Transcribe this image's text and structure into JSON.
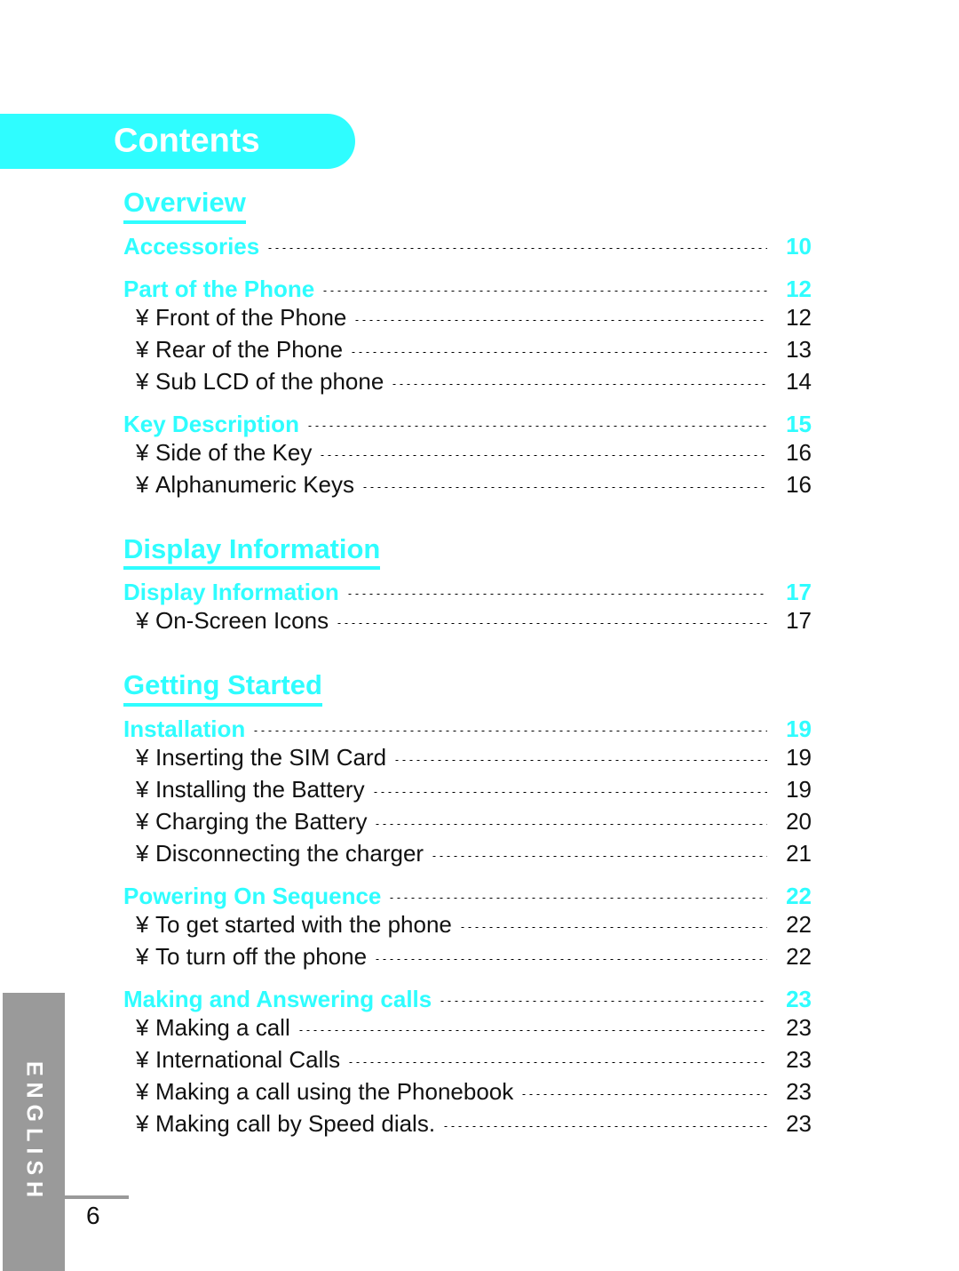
{
  "banner": {
    "title": "Contents"
  },
  "bullet_glyph": "¥",
  "colors": {
    "accent_cyan": "#2ffdff",
    "tab_gray": "#9a9a9a",
    "body_black": "#111111",
    "banner_text": "#ffffff"
  },
  "sections": [
    {
      "title": "Overview",
      "groups": [
        {
          "main": {
            "label": "Accessories",
            "page": "10"
          },
          "subs": []
        },
        {
          "main": {
            "label": "Part of the Phone",
            "page": "12"
          },
          "subs": [
            {
              "label": "Front of the Phone",
              "page": "12"
            },
            {
              "label": "Rear of the Phone",
              "page": "13"
            },
            {
              "label": "Sub LCD of the phone",
              "page": "14"
            }
          ]
        },
        {
          "main": {
            "label": "Key Description",
            "page": "15"
          },
          "subs": [
            {
              "label": "Side of the Key",
              "page": "16"
            },
            {
              "label": "Alphanumeric Keys",
              "page": "16"
            }
          ]
        }
      ]
    },
    {
      "title": "Display Information",
      "groups": [
        {
          "main": {
            "label": "Display Information",
            "page": "17"
          },
          "subs": [
            {
              "label": "On-Screen Icons",
              "page": "17"
            }
          ]
        }
      ]
    },
    {
      "title": "Getting Started",
      "groups": [
        {
          "main": {
            "label": "Installation",
            "page": "19"
          },
          "subs": [
            {
              "label": "Inserting the SIM Card",
              "page": "19"
            },
            {
              "label": "Installing the Battery",
              "page": "19"
            },
            {
              "label": "Charging the Battery",
              "page": "20"
            },
            {
              "label": "Disconnecting the charger",
              "page": "21"
            }
          ]
        },
        {
          "main": {
            "label": "Powering On Sequence",
            "page": "22"
          },
          "subs": [
            {
              "label": "To get started with the phone",
              "page": "22"
            },
            {
              "label": "To turn off the phone",
              "page": "22"
            }
          ]
        },
        {
          "main": {
            "label": "Making and Answering calls",
            "page": "23"
          },
          "subs": [
            {
              "label": "Making a call",
              "page": "23"
            },
            {
              "label": "International Calls",
              "page": "23"
            },
            {
              "label": "Making a call using the Phonebook",
              "page": "23"
            },
            {
              "label": "Making call by Speed dials.",
              "page": "23"
            }
          ]
        }
      ]
    }
  ],
  "language_tab": {
    "label": "ENGLISH"
  },
  "footer": {
    "page_number": "6"
  }
}
